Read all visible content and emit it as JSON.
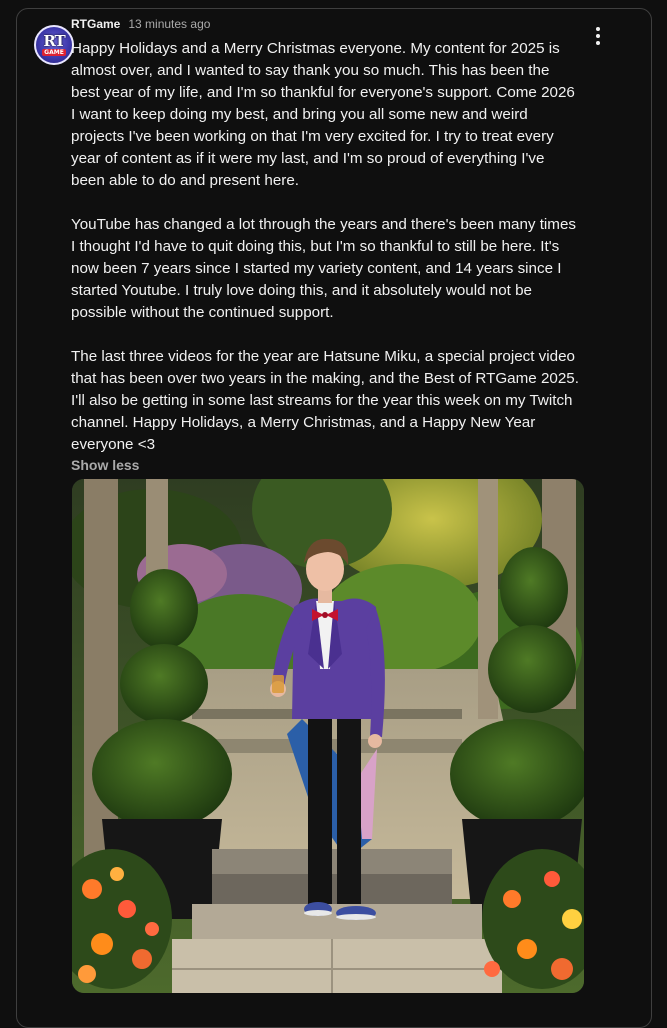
{
  "post": {
    "author": "RTGame",
    "timestamp": "13 minutes ago",
    "avatar": {
      "line1": "RT",
      "line2": "GAME"
    },
    "paragraphs": [
      "Happy Holidays and a Merry Christmas everyone. My content for 2025 is almost over, and I wanted to say thank you so much. This has been the best year of my life, and I'm so thankful for everyone's support. Come 2026 I want to keep doing my best, and bring you all some new and weird projects I've been working on that I'm very excited for. I try to treat every year of content as if it were my last, and I'm so proud of everything I've been able to do and present here.",
      "YouTube has changed a lot through the years and there's been many times I thought I'd have to quit doing this, but I'm so thankful to still be here. It's now been 7 years since I started my variety content, and 14 years since I started Youtube. I truly love doing this, and it absolutely would not be possible without the continued support.",
      "The last three videos for the year are Hatsune Miku, a special project video that has been over two years in the making, and the Best of RTGame 2025. I'll also be getting in some last streams for the year this week on my Twitch channel. Happy Holidays, a Merry Christmas, and a Happy New Year everyone <3"
    ],
    "show_less_label": "Show less"
  },
  "icons": {
    "menu": "more-vert-icon"
  },
  "colors": {
    "background": "#0f0f0f",
    "border": "#3f3f3f",
    "text_primary": "#f1f1f1",
    "text_secondary": "#aaaaaa",
    "jacket_purple": "#5b3fa0",
    "bowtie_red": "#c4122f"
  }
}
